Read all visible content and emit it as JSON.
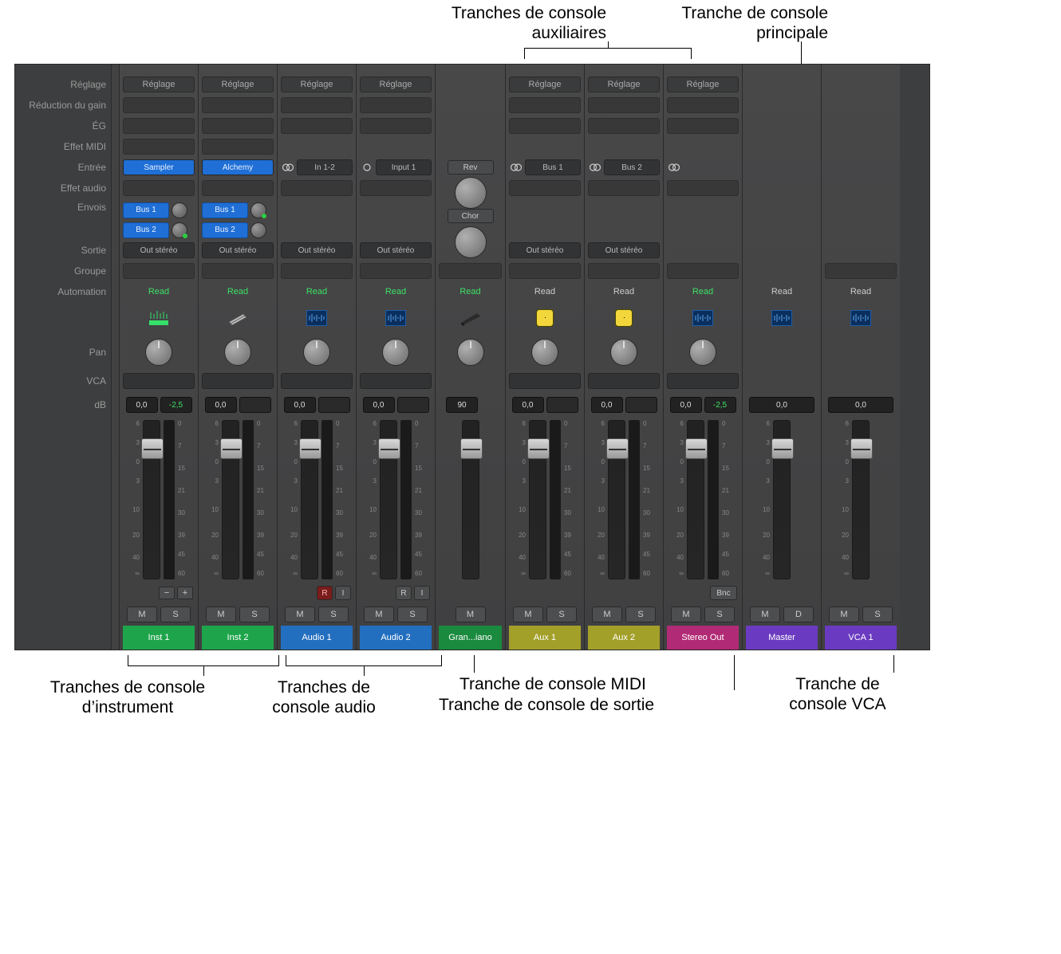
{
  "row_labels": {
    "setting": "Réglage",
    "gain_reduction": "Réduction du gain",
    "eq": "ÉG",
    "midi_fx": "Effet MIDI",
    "input": "Entrée",
    "audio_fx": "Effet audio",
    "sends": "Envois",
    "output": "Sortie",
    "group": "Groupe",
    "automation": "Automation",
    "pan": "Pan",
    "vca": "VCA",
    "db": "dB"
  },
  "btn": {
    "reglage": "Réglage",
    "read": "Read",
    "m": "M",
    "s": "S",
    "d": "D",
    "r": "R",
    "i": "I",
    "minus": "−",
    "plus": "+",
    "bnc": "Bnc"
  },
  "scale_left": [
    "6",
    "3",
    "0",
    "3",
    "10",
    "20",
    "40",
    "∞"
  ],
  "scale_right": [
    "0",
    "7",
    "15",
    "21",
    "30",
    "39",
    "45",
    "60"
  ],
  "strips": {
    "inst1": {
      "input": "Sampler",
      "send1": "Bus 1",
      "send2": "Bus 2",
      "output": "Out stéréo",
      "automation": "Read",
      "db": "0,0",
      "peak": "-2,5",
      "name": "Inst 1"
    },
    "inst2": {
      "input": "Alchemy",
      "send1": "Bus 1",
      "send2": "Bus 2",
      "output": "Out stéréo",
      "automation": "Read",
      "db": "0,0",
      "name": "Inst 2"
    },
    "audio1": {
      "input": "In 1-2",
      "output": "Out stéréo",
      "automation": "Read",
      "db": "0,0",
      "name": "Audio 1"
    },
    "audio2": {
      "input": "Input 1",
      "output": "Out stéréo",
      "automation": "Read",
      "db": "0,0",
      "name": "Audio 2"
    },
    "midi": {
      "fx1": "Rev",
      "fx2": "Chor",
      "automation": "Read",
      "db": "90",
      "name": "Gran...iano"
    },
    "aux1": {
      "input": "Bus 1",
      "output": "Out stéréo",
      "automation": "Read",
      "db": "0,0",
      "name": "Aux 1"
    },
    "aux2": {
      "input": "Bus 2",
      "output": "Out stéréo",
      "automation": "Read",
      "db": "0,0",
      "name": "Aux 2"
    },
    "stereo_out": {
      "automation": "Read",
      "db": "0,0",
      "peak": "-2,5",
      "name": "Stereo Out"
    },
    "master": {
      "automation": "Read",
      "db": "0,0",
      "name": "Master"
    },
    "vca1": {
      "automation": "Read",
      "db": "0,0",
      "name": "VCA 1"
    }
  },
  "callouts": {
    "aux": "Tranches de console\nauxiliaires",
    "master": "Tranche de console\nprincipale",
    "inst": "Tranches de console\nd’instrument",
    "audio": "Tranches de\nconsole audio",
    "midi": "Tranche de console MIDI",
    "output": "Tranche de console de sortie",
    "vca": "Tranche de\nconsole VCA"
  }
}
